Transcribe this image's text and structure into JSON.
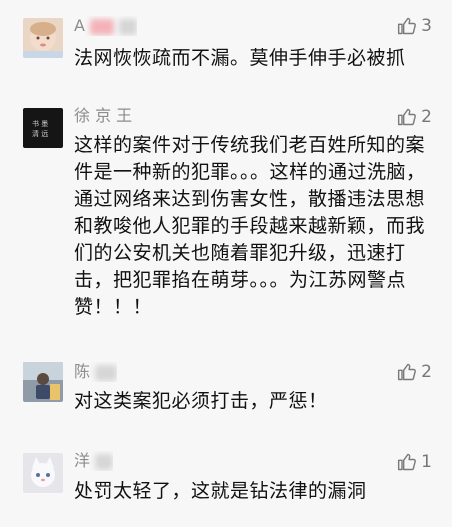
{
  "comments": [
    {
      "name": "A",
      "likes": "3",
      "text": "法网恢恢疏而不漏。莫伸手伸手必被抓",
      "avatar": "baby-photo"
    },
    {
      "name": "徐 京 王",
      "likes": "2",
      "text": "这样的案件对于传统我们老百姓所知的案件是一种新的犯罪。。。这样的通过洗脑，通过网络来达到伤害女性，散播违法思想和教唆他人犯罪的手段越来越新颖，而我们的公安机关也随着罪犯升级，迅速打击，把犯罪掐在萌芽。。。为江苏网警点赞！！！",
      "avatar": "dark-calligraphy"
    },
    {
      "name": "陈",
      "likes": "2",
      "text": "对这类案犯必须打击，严惩！",
      "avatar": "person-photo"
    },
    {
      "name": "洋",
      "likes": "1",
      "text": "处罚太轻了，这就是钻法律的漏洞",
      "avatar": "cat-photo"
    }
  ],
  "icons": {
    "like": "thumbs-up-icon"
  },
  "colors": {
    "background": "#f7f7f7",
    "name_gray": "#8d8d8d",
    "text": "#111111",
    "icon_gray": "#7a7a7a"
  }
}
